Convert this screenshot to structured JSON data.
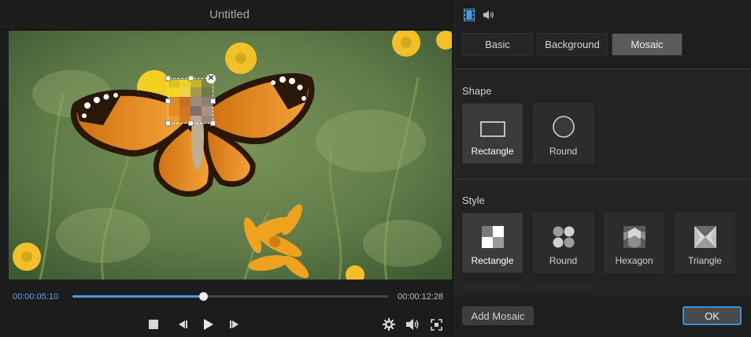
{
  "window": {
    "title": "Untitled"
  },
  "player": {
    "current_time": "00:00:05:10",
    "total_time": "00:00:12:28",
    "progress": 0.415
  },
  "panel": {
    "top_icons": [
      "film-strip-icon",
      "speaker-icon"
    ],
    "tabs": [
      {
        "label": "Basic",
        "active": false
      },
      {
        "label": "Background",
        "active": false
      },
      {
        "label": "Mosaic",
        "active": true
      }
    ],
    "shape": {
      "label": "Shape",
      "options": [
        {
          "label": "Rectangle",
          "icon": "rectangle-outline-icon",
          "selected": true
        },
        {
          "label": "Round",
          "icon": "circle-outline-icon",
          "selected": false
        }
      ]
    },
    "style": {
      "label": "Style",
      "options": [
        {
          "label": "Rectangle",
          "icon": "checker-squares-icon",
          "selected": true
        },
        {
          "label": "Round",
          "icon": "circle-grid-icon",
          "selected": false
        },
        {
          "label": "Hexagon",
          "icon": "hexagon-pattern-icon",
          "selected": false
        },
        {
          "label": "Triangle",
          "icon": "triangle-pattern-icon",
          "selected": false
        }
      ]
    },
    "add_mosaic_label": "Add Mosaic",
    "ok_label": "OK"
  },
  "colors": {
    "accent": "#4a9ae8",
    "ok_border": "#3e8fd6",
    "current_time": "#5aa2e6"
  }
}
